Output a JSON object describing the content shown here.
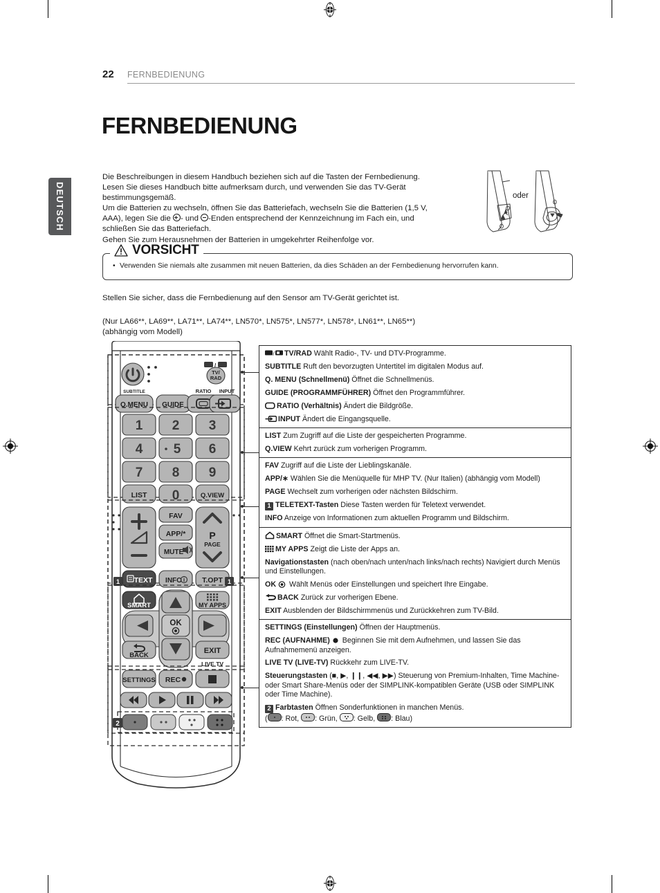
{
  "page": {
    "number": "22",
    "section": "FERNBEDIENUNG",
    "title": "FERNBEDIENUNG",
    "language_tab": "DEUTSCH"
  },
  "intro": {
    "line1": "Die Beschreibungen in diesem Handbuch beziehen sich auf die Tasten der Fernbedienung.",
    "line2": "Lesen Sie dieses Handbuch bitte aufmerksam durch, und verwenden Sie das TV-Gerät",
    "line3": "bestimmungsgemäß.",
    "line4a": "Um die Batterien zu wechseln, öffnen Sie das Batteriefach, wechseln Sie die Batterien (1,5 V,",
    "line4b": "AAA), legen Sie die ",
    "line4c": "- und ",
    "line4d": "-Enden entsprechend der Kennzeichnung im Fach ein, und",
    "line5": "schließen Sie das Batteriefach.",
    "line6": "Gehen Sie zum Herausnehmen der Batterien in umgekehrter Reihenfolge vor."
  },
  "battery_illustration": {
    "or_label": "oder"
  },
  "caution": {
    "title": "VORSICHT",
    "bullet": "•",
    "text": "Verwenden Sie niemals alte zusammen mit neuen Batterien, da dies Schäden an der Fernbedienung hervorrufen kann."
  },
  "notes": {
    "sensor": "Stellen Sie sicher, dass die Fernbedienung auf den Sensor am TV-Gerät gerichtet ist.",
    "models_line1": "(Nur  LA66**, LA69**, LA71**, LA74**, LN570*, LN575*, LN577*, LN578*, LN61**, LN65**)",
    "models_line2": "(abhängig vom Modell)"
  },
  "remote": {
    "buttons": {
      "power": "power-icon",
      "tvrad_top": "TV/RAD icon",
      "tvrad": "TV/ RAD",
      "subtitle": "SUBTITLE",
      "qmenu": "Q.MENU",
      "guide": "GUIDE",
      "ratio": "RATIO",
      "input": "INPUT",
      "num1": "1",
      "num2": "2",
      "num3": "3",
      "num4": "4",
      "num5": "5",
      "num6": "6",
      "num7": "7",
      "num8": "8",
      "num9": "9",
      "list": "LIST",
      "num0": "0",
      "qview": "Q.VIEW",
      "fav": "FAV",
      "app": "APP/*",
      "mute": "MUTE",
      "page_p": "P",
      "page_label": "PAGE",
      "text": "TEXT",
      "info": "INFO",
      "topt": "T.OPT",
      "smart": "SMART",
      "myapps": "MY APPS",
      "ok": "OK",
      "back": "BACK",
      "exit": "EXIT",
      "livetv": "LIVE TV",
      "settings": "SETTINGS",
      "rec": "REC"
    },
    "markers": {
      "one": "1",
      "two": "2"
    }
  },
  "descriptions": [
    {
      "lines": [
        {
          "icon": "tv-radio-icon",
          "bold": "TV/RAD",
          "text": " Wählt Radio-, TV- und DTV-Programme."
        },
        {
          "icon": "",
          "bold": "SUBTITLE",
          "text": " Ruft den bevorzugten Untertitel im digitalen Modus auf."
        },
        {
          "icon": "",
          "bold": "Q. MENU (Schnellmenü)",
          "text": " Öffnet die Schnellmenüs."
        },
        {
          "icon": "",
          "bold": "GUIDE (PROGRAMMFÜHRER)",
          "text": " Öffnet den Programmführer."
        },
        {
          "icon": "ratio-icon",
          "bold": "RATIO (Verhältnis)",
          "text": " Ändert die Bildgröße."
        },
        {
          "icon": "input-icon",
          "bold": "INPUT",
          "text": " Ändert die Eingangsquelle."
        }
      ]
    },
    {
      "lines": [
        {
          "icon": "",
          "bold": "LIST",
          "text": " Zum Zugriff auf die Liste der gespeicherten Programme."
        },
        {
          "icon": "",
          "bold": "Q.VIEW",
          "text": " Kehrt zurück zum vorherigen Programm."
        }
      ]
    },
    {
      "lines": [
        {
          "icon": "",
          "bold": "FAV",
          "text": " Zugriff auf die Liste der Lieblingskanäle."
        },
        {
          "icon": "",
          "bold": "APP/∗",
          "text": " Wählen Sie die Menüquelle für MHP TV. (Nur Italien) (abhängig vom Modell)"
        },
        {
          "icon": "",
          "bold": "PAGE",
          "text": " Wechselt zum vorherigen oder nächsten Bildschirm."
        },
        {
          "icon": "num-1-badge",
          "bold": "TELETEXT-Tasten",
          "text": " Diese Tasten werden für Teletext verwendet."
        },
        {
          "icon": "",
          "bold": "INFO",
          "text": " Anzeige von Informationen zum aktuellen Programm und Bildschirm."
        }
      ]
    },
    {
      "lines": [
        {
          "icon": "home-icon",
          "bold": "SMART",
          "text": " Öffnet die Smart-Startmenüs."
        },
        {
          "icon": "grid-icon",
          "bold": "MY APPS",
          "text": " Zeigt die Liste der Apps an."
        },
        {
          "icon": "",
          "bold": "Navigationstasten",
          "text": " (nach oben/nach unten/nach links/nach rechts) Navigiert durch Menüs und Einstellungen."
        },
        {
          "icon": "ok-dot-icon-after",
          "bold": "OK",
          "text": " Wählt Menüs oder Einstellungen und speichert Ihre Eingabe."
        },
        {
          "icon": "back-arrow-icon",
          "bold": "BACK",
          "text": " Zurück zur vorherigen Ebene."
        },
        {
          "icon": "",
          "bold": "EXIT",
          "text": " Ausblenden der Bildschirmmenüs und Zurückkehren zum TV-Bild."
        }
      ]
    },
    {
      "lines": [
        {
          "icon": "",
          "bold": "SETTINGS (Einstellungen)",
          "text": " Öffnen der Hauptmenüs."
        },
        {
          "icon": "rec-dot-icon-after",
          "bold": "REC (AUFNAHME)",
          "text": " Beginnen Sie mit dem Aufnehmen, und lassen Sie das Aufnahmemenü anzeigen."
        },
        {
          "icon": "",
          "bold": "LIVE TV (LIVE-TV)",
          "text": " Rückkehr zum LIVE-TV."
        },
        {
          "icon": "",
          "bold": "Steuerungstasten",
          "text": " (■, ▶, ❙❙, ◀◀, ▶▶) Steuerung von Premium-Inhalten, Time Machine- oder Smart Share-Menüs oder der SIMPLINK-kompatiblen Geräte (USB oder SIMPLINK oder Time Machine)."
        },
        {
          "icon": "num-2-badge",
          "bold": "Farbtasten",
          "text": " Öffnen Sonderfunktionen in manchen Menüs."
        }
      ],
      "color_legend": {
        "open": "(",
        "red": ": Rot, ",
        "green": ": Grün, ",
        "yellow": ": Gelb, ",
        "blue": ": Blau)"
      }
    }
  ],
  "colors": {
    "tab_gray": "#58595b",
    "rule_gray": "#9b9b9b",
    "text": "#1c1c1c",
    "border": "#2a2a2a",
    "button_fill": "#b5b5b5",
    "button_dark": "#4a4a4a"
  }
}
